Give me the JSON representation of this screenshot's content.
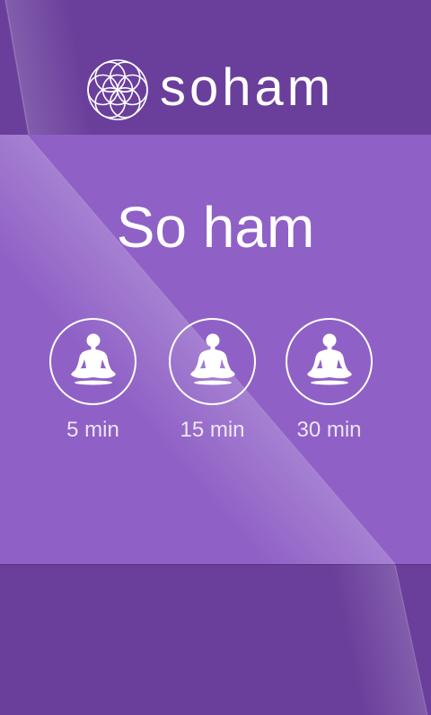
{
  "colors": {
    "header": "#6a3f9c",
    "panel": "#8f61c6",
    "footer": "#6a3f9c",
    "text": "#ffffff",
    "label": "#ede4f8"
  },
  "header": {
    "logo_icon": "flower-of-life-icon",
    "brand": "soham"
  },
  "main": {
    "title": "So ham",
    "sessions": [
      {
        "label": "5 min",
        "icon": "meditation-icon"
      },
      {
        "label": "15 min",
        "icon": "meditation-icon"
      },
      {
        "label": "30 min",
        "icon": "meditation-icon"
      }
    ]
  }
}
